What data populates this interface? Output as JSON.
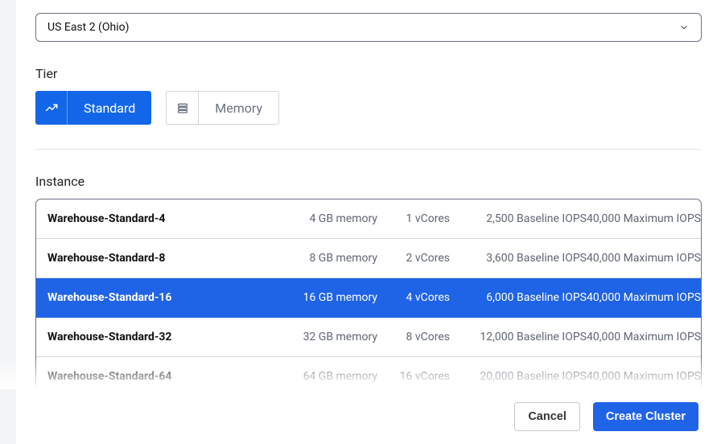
{
  "region": {
    "value": "US East 2 (Ohio)"
  },
  "tier": {
    "label": "Tier",
    "options": [
      {
        "key": "standard",
        "label": "Standard",
        "icon": "trend-icon",
        "selected": true
      },
      {
        "key": "memory",
        "label": "Memory",
        "icon": "stack-icon",
        "selected": false
      }
    ]
  },
  "instance": {
    "label": "Instance",
    "rows": [
      {
        "name": "Warehouse-Standard-4",
        "memory": "4 GB memory",
        "cores": "1 vCores",
        "baseline": "2,500 Baseline IOPS",
        "max": "40,000 Maximum IOPS",
        "selected": false
      },
      {
        "name": "Warehouse-Standard-8",
        "memory": "8 GB memory",
        "cores": "2 vCores",
        "baseline": "3,600 Baseline IOPS",
        "max": "40,000 Maximum IOPS",
        "selected": false
      },
      {
        "name": "Warehouse-Standard-16",
        "memory": "16 GB memory",
        "cores": "4 vCores",
        "baseline": "6,000 Baseline IOPS",
        "max": "40,000 Maximum IOPS",
        "selected": true
      },
      {
        "name": "Warehouse-Standard-32",
        "memory": "32 GB memory",
        "cores": "8 vCores",
        "baseline": "12,000 Baseline IOPS",
        "max": "40,000 Maximum IOPS",
        "selected": false
      },
      {
        "name": "Warehouse-Standard-64",
        "memory": "64 GB memory",
        "cores": "16 vCores",
        "baseline": "20,000 Baseline IOPS",
        "max": "40,000 Maximum IOPS",
        "selected": false
      }
    ]
  },
  "footer": {
    "cancel": "Cancel",
    "create": "Create Cluster"
  }
}
